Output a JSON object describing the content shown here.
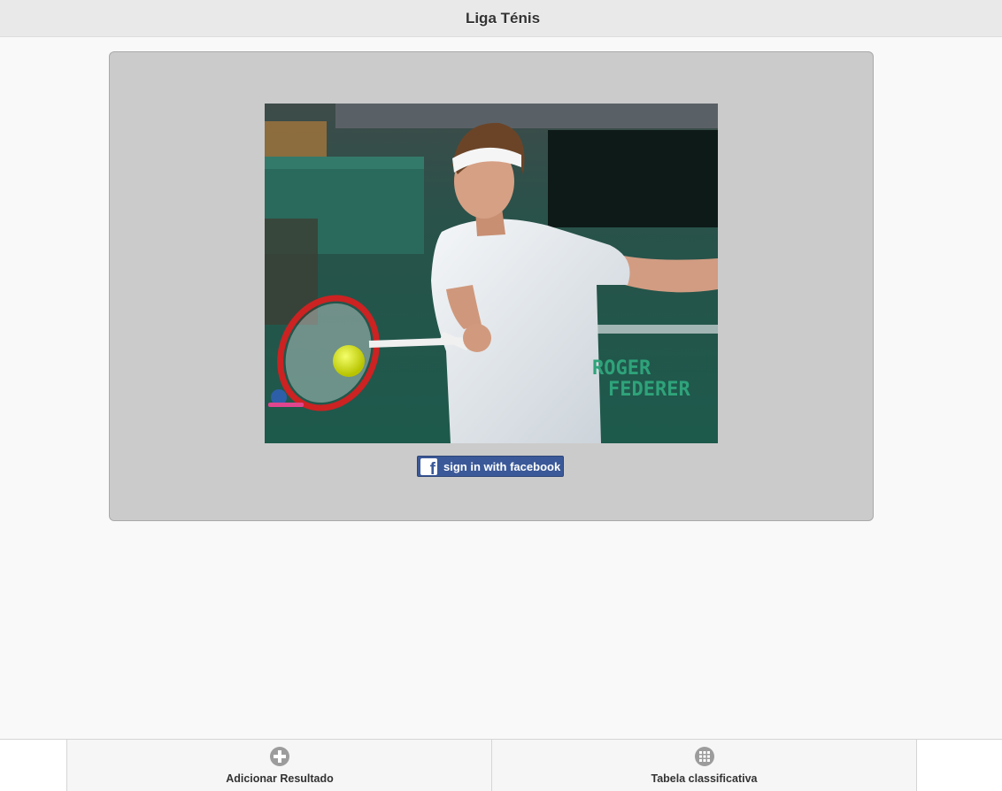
{
  "header": {
    "title": "Liga Ténis"
  },
  "hero": {
    "photo_caption_line1": "ROGER",
    "photo_caption_line2": "FEDERER",
    "login_button_label": "sign in with facebook"
  },
  "navbar": {
    "items": [
      {
        "label": "Adicionar Resultado",
        "icon": "plus-circle-icon"
      },
      {
        "label": "Tabela classificativa",
        "icon": "grid-circle-icon"
      }
    ]
  },
  "colors": {
    "header_bg": "#e9e9e9",
    "panel_bg": "#cbcbcb",
    "facebook_blue": "#3b5998",
    "court_green": "#1f5e4f"
  }
}
